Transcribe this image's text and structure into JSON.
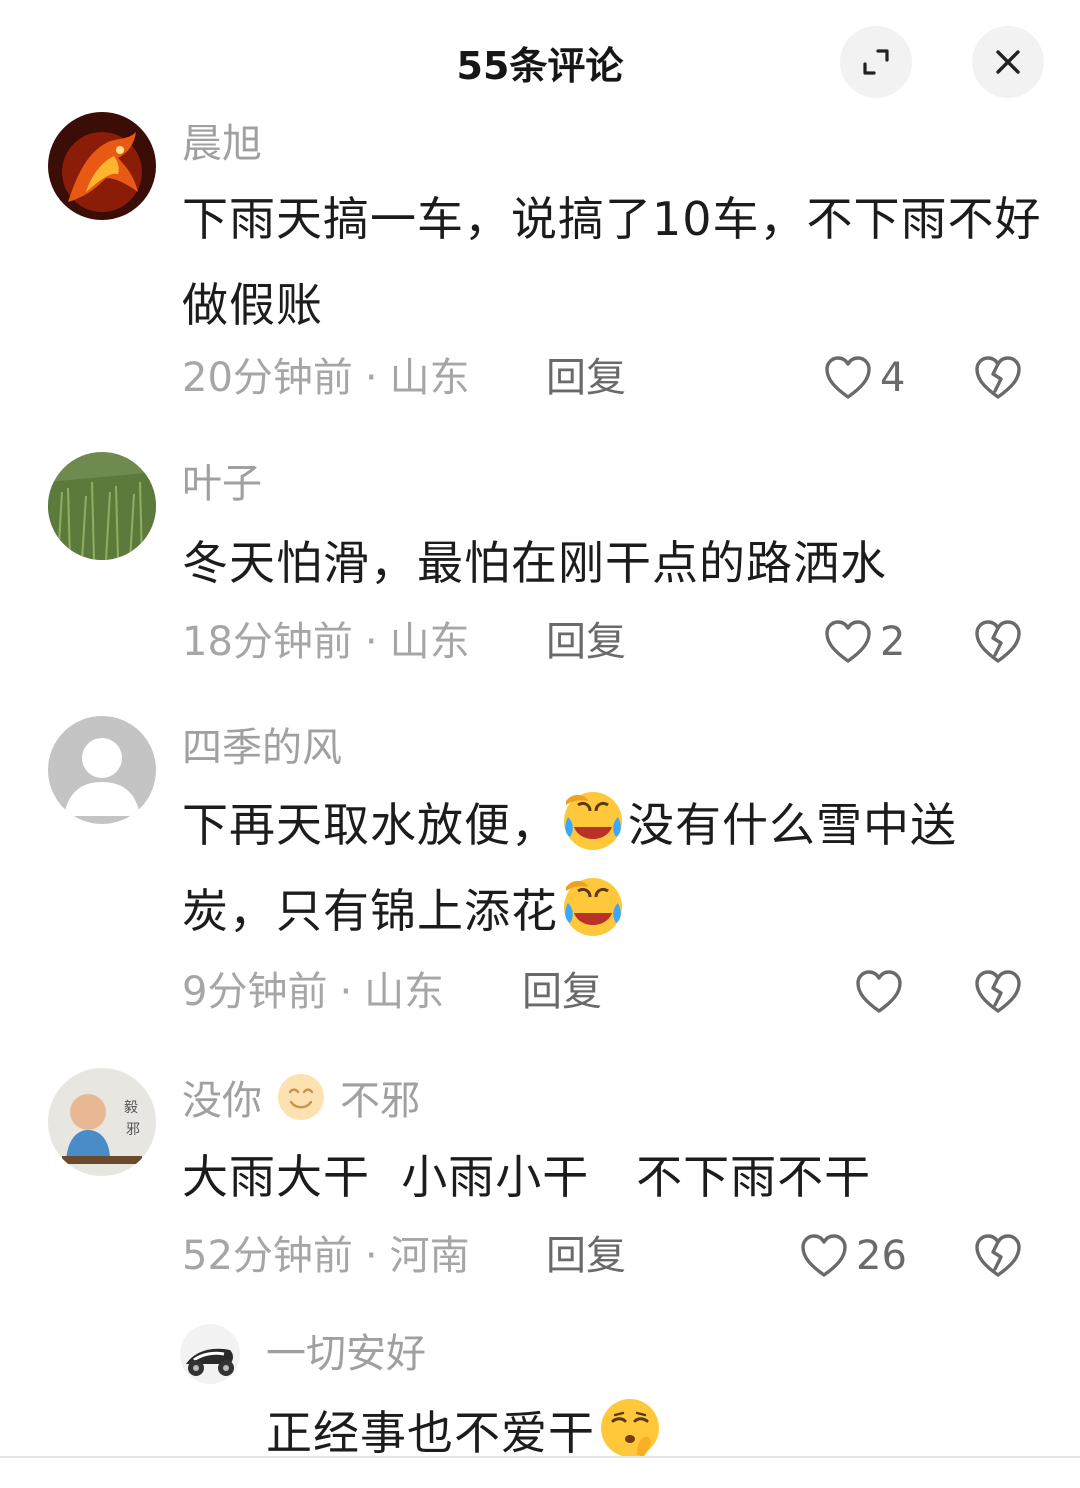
{
  "header": {
    "title": "55条评论",
    "expand_icon": "expand-icon",
    "close_icon": "close-icon"
  },
  "comments": [
    {
      "username": "晨旭",
      "text": "下雨天搞一车，说搞了10车，不下雨不好做假账",
      "time": "20分钟前",
      "location": "山东",
      "reply": "回复",
      "likes": "4"
    },
    {
      "username": "叶子",
      "text": "冬天怕滑，最怕在刚干点的路洒水",
      "time": "18分钟前",
      "location": "山东",
      "reply": "回复",
      "likes": "2"
    },
    {
      "username": "四季的风",
      "text_part1": "下再天取水放便，",
      "text_part2": "没有什么雪中送炭，只有锦上添花",
      "time": "9分钟前",
      "location": "山东",
      "reply": "回复",
      "likes": ""
    },
    {
      "username_part1": "没你",
      "username_part2": "不邪",
      "text": "大雨大干  小雨小干   不下雨不干",
      "time": "52分钟前",
      "location": "河南",
      "reply": "回复",
      "likes": "26"
    }
  ],
  "sub_reply": {
    "username": "一切安好",
    "text": "正经事也不爱干"
  },
  "meta_separator": "·",
  "colors": {
    "text": "#1c1c1c",
    "muted": "#a0a0a0",
    "icon": "#6a6a6a",
    "button_bg": "#f2f2f2"
  }
}
